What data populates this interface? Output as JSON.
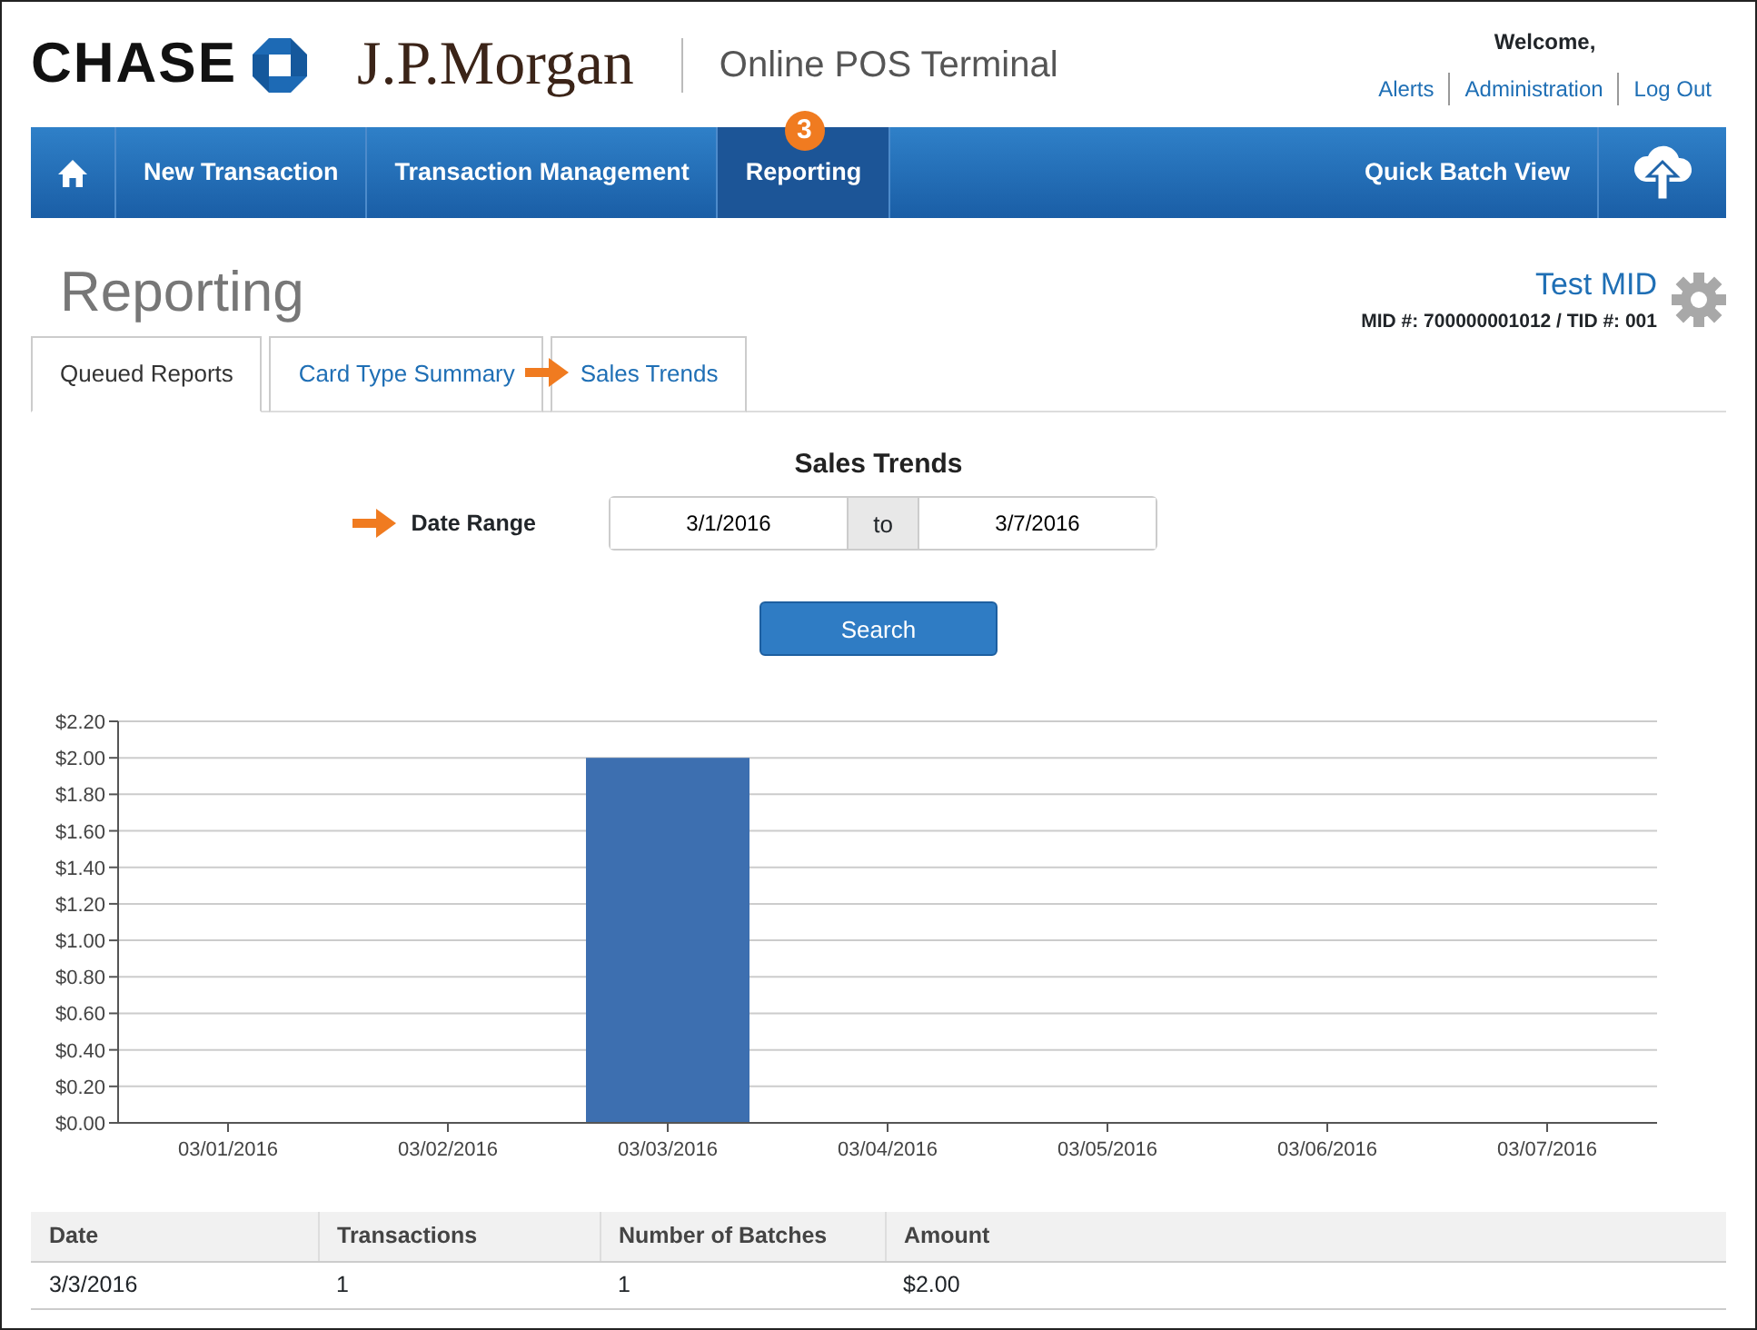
{
  "header": {
    "brand": "CHASE",
    "brand_2": "J.P.Morgan",
    "app_title": "Online POS Terminal",
    "welcome": "Welcome,",
    "links": [
      "Alerts",
      "Administration",
      "Log Out"
    ]
  },
  "nav": {
    "items": [
      {
        "label": "New Transaction",
        "selected": false
      },
      {
        "label": "Transaction Management",
        "selected": false
      },
      {
        "label": "Reporting",
        "selected": true,
        "callout": "3"
      }
    ],
    "quick_batch": "Quick Batch View"
  },
  "page": {
    "title": "Reporting",
    "mid_name": "Test MID",
    "mid_info": "MID #: 700000001012 / TID #: 001"
  },
  "tabs": [
    {
      "label": "Queued Reports",
      "selected": true,
      "arrow": false
    },
    {
      "label": "Card Type Summary",
      "selected": false,
      "arrow": false
    },
    {
      "label": "Sales Trends",
      "selected": false,
      "arrow": true
    }
  ],
  "report": {
    "title": "Sales Trends",
    "date_range": {
      "label": "Date Range",
      "arrow": true,
      "from": "3/1/2016",
      "separator": "to",
      "to": "3/7/2016"
    },
    "search_button": "Search",
    "chart_data": {
      "type": "bar",
      "categories": [
        "03/01/2016",
        "03/02/2016",
        "03/03/2016",
        "03/04/2016",
        "03/05/2016",
        "03/06/2016",
        "03/07/2016"
      ],
      "series": [
        {
          "color": "#3d6fb0",
          "values": [
            0,
            0,
            2,
            0,
            0,
            0,
            0
          ]
        }
      ],
      "ylim": [
        0,
        2.2
      ],
      "grid": true,
      "yticks": [
        {
          "value": 0,
          "label": "$0.00"
        },
        {
          "value": 0.2,
          "label": "$0.20"
        },
        {
          "value": 0.4,
          "label": "$0.40"
        },
        {
          "value": 0.6,
          "label": "$0.60"
        },
        {
          "value": 0.8,
          "label": "$0.80"
        },
        {
          "value": 1,
          "label": "$1.00"
        },
        {
          "value": 1.2,
          "label": "$1.20"
        },
        {
          "value": 1.4,
          "label": "$1.40"
        },
        {
          "value": 1.6,
          "label": "$1.60"
        },
        {
          "value": 1.8,
          "label": "$1.80"
        },
        {
          "value": 2,
          "label": "$2.00"
        },
        {
          "value": 2.2,
          "label": "$2.20"
        }
      ]
    }
  },
  "table": {
    "columns": [
      "Date",
      "Transactions",
      "Number of Batches",
      "Amount"
    ],
    "rows": [
      [
        "3/3/2016",
        "1",
        "1",
        "$2.00"
      ]
    ]
  }
}
